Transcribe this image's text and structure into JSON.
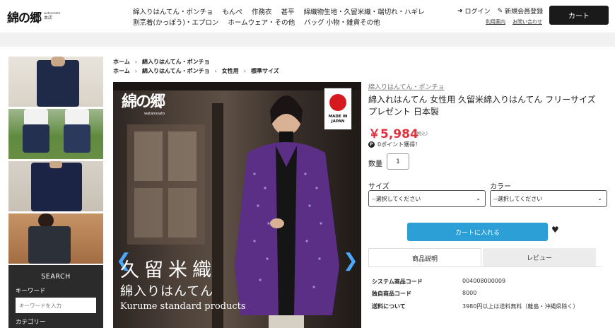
{
  "header": {
    "logo_text": "綿の郷",
    "logo_en": "watanosato",
    "logo_sub": "本店",
    "nav_row1": [
      "綿入りはんてん・ポンチョ",
      "もんぺ",
      "作務衣",
      "甚平",
      "綿織物生地・久留米織・端切れ・ハギレ"
    ],
    "nav_row2": [
      "割烹着(かっぽう)・エプロン",
      "ホームウェア・その他",
      "バッグ 小物・雑貨その他"
    ],
    "login": "ログイン",
    "register": "新規会員登録",
    "guide": "利用案内",
    "contact": "お問い合わせ",
    "cart": "カート"
  },
  "sidebar": {
    "search_title": "SEARCH",
    "keyword_label": "キーワード",
    "keyword_placeholder": "キーワードを入力",
    "category_label": "カテゴリー"
  },
  "breadcrumbs": {
    "row1": [
      "ホーム",
      "綿入りはんてん・ポンチョ"
    ],
    "row2": [
      "ホーム",
      "綿入りはんてん・ポンチョ",
      "女性用",
      "標準サイズ"
    ]
  },
  "image": {
    "logo": "綿の郷",
    "logo_sub": "watanosato",
    "badge_line1": "MADE IN",
    "badge_line2": "JAPAN",
    "caption1": "久留米織",
    "caption2": "綿入りはんてん",
    "caption3": "Kurume standard products"
  },
  "product": {
    "category": "綿入りはんてん・ポンチョ",
    "title": "綿入れはんてん 女性用 久留米綿入りはんてん フリーサイズ プレゼント 日本製",
    "price": "￥5,984",
    "tax": "(税込)",
    "points": "0ポイント獲得！",
    "qty_label": "数量",
    "qty_value": "1",
    "size_label": "サイズ",
    "size_value": "--選択してください",
    "color_label": "カラー",
    "color_value": "--選択してください",
    "add_to_cart": "カートに入れる",
    "tab_desc": "商品説明",
    "tab_review": "レビュー",
    "specs": [
      {
        "k": "システム商品コード",
        "v": "004008000009"
      },
      {
        "k": "独自商品コード",
        "v": "8000"
      },
      {
        "k": "送料について",
        "v": "3980円以上は送料無料（離島・沖縄県除く）"
      }
    ]
  },
  "colors": {
    "accent_blue": "#2b9fd6",
    "price_red": "#e0313b",
    "dark": "#1a1a1a"
  }
}
